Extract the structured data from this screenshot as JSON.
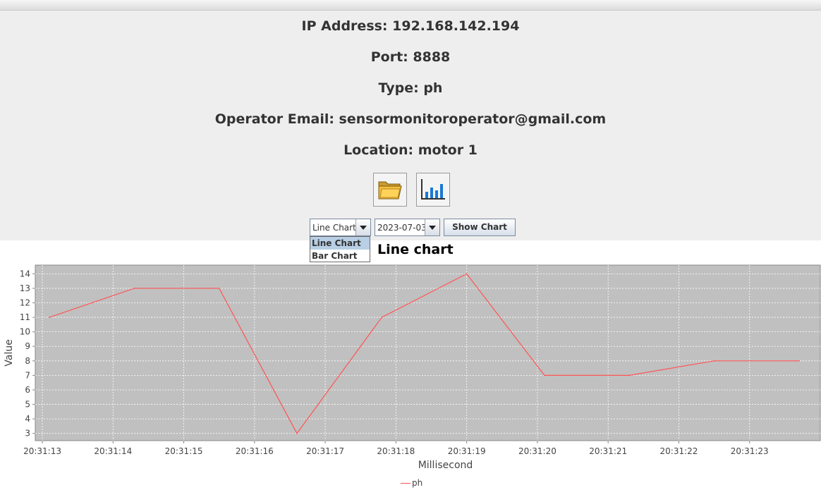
{
  "info": {
    "ip": "IP Address: 192.168.142.194",
    "port": "Port: 8888",
    "type": "Type: ph",
    "email": "Operator Email: sensormonitoroperator@gmail.com",
    "location": "Location: motor 1"
  },
  "toolbar": {
    "open_icon": "folder-open-icon",
    "chart_icon": "bar-chart-icon"
  },
  "controls": {
    "chart_type_selected": "Line Chart",
    "chart_type_options": [
      "Line Chart",
      "Bar Chart"
    ],
    "date_selected": "2023-07-03",
    "show_button": "Show Chart"
  },
  "chart_title": "Line chart",
  "colors": {
    "plot_background": "#c0c0c0",
    "series_line": "#ff5555",
    "gridline": "#ffffff",
    "dropdown_selection": "#b8cfe5"
  },
  "chart_data": {
    "type": "line",
    "xlabel": "Millisecond",
    "ylabel": "Value",
    "x_ticks": [
      "20:31:13",
      "20:31:14",
      "20:31:15",
      "20:31:16",
      "20:31:17",
      "20:31:18",
      "20:31:19",
      "20:31:20",
      "20:31:21",
      "20:31:22",
      "20:31:23"
    ],
    "y_ticks": [
      3,
      4,
      5,
      6,
      7,
      8,
      9,
      10,
      11,
      12,
      13,
      14
    ],
    "ylim": [
      2.5,
      14.6
    ],
    "xlim": [
      "20:31:12.9",
      "20:31:24.0"
    ],
    "grid": true,
    "legend_position": "bottom",
    "series": [
      {
        "name": "ph",
        "points": [
          {
            "t": "20:31:13.1",
            "y": 11
          },
          {
            "t": "20:31:14.3",
            "y": 13
          },
          {
            "t": "20:31:15.5",
            "y": 13
          },
          {
            "t": "20:31:16.6",
            "y": 3
          },
          {
            "t": "20:31:17.8",
            "y": 11
          },
          {
            "t": "20:31:19.0",
            "y": 14
          },
          {
            "t": "20:31:20.1",
            "y": 7
          },
          {
            "t": "20:31:21.3",
            "y": 7
          },
          {
            "t": "20:31:22.5",
            "y": 8
          },
          {
            "t": "20:31:23.7",
            "y": 8
          }
        ]
      }
    ]
  }
}
